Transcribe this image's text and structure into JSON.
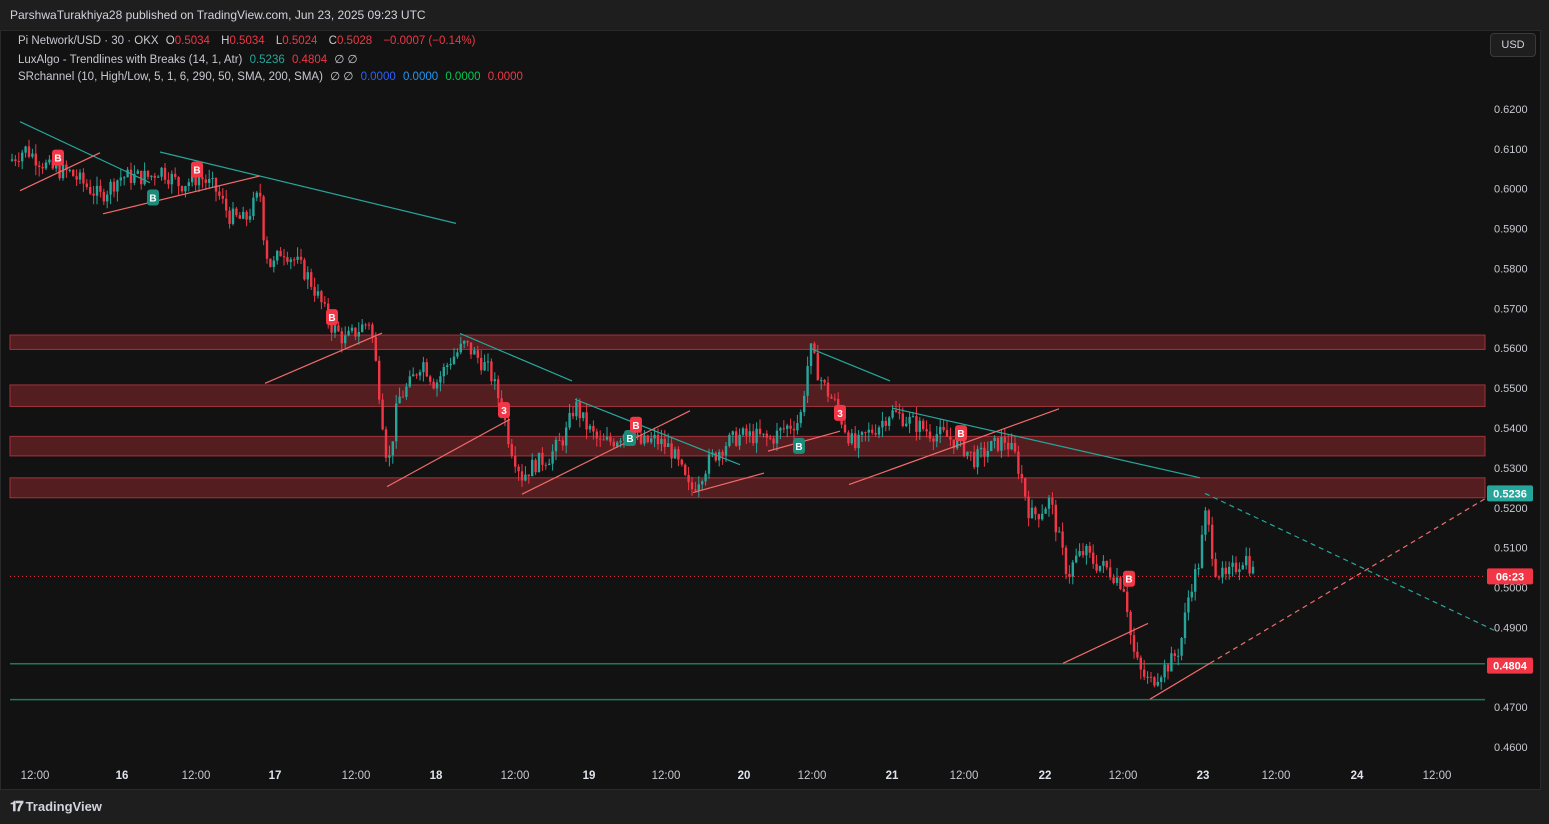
{
  "header": {
    "publisher_text": "ParshwaTurakhiya28 published on TradingView.com, Jun 23, 2025 09:23 UTC"
  },
  "legend": {
    "symbol": "Pi Network/USD · 30 · OKX",
    "o_label": "O",
    "o_value": "0.5034",
    "h_label": "H",
    "h_value": "0.5034",
    "l_label": "L",
    "l_value": "0.5024",
    "c_label": "C",
    "c_value": "0.5028",
    "change": "−0.0007 (−0.14%)",
    "indicator1_name": "LuxAlgo - Trendlines with Breaks (14, 1, Atr)",
    "indicator1_v1": "0.5236",
    "indicator1_v2": "0.4804",
    "indicator1_rest": "∅ ∅",
    "indicator2_name": "SRchannel (10, High/Low, 5, 1, 6, 290, 50, SMA, 200, SMA)",
    "indicator2_rest": "∅ ∅",
    "indicator2_v1": "0.0000",
    "indicator2_v2": "0.0000",
    "indicator2_v3": "0.0000",
    "indicator2_v4": "0.0000"
  },
  "toolbar": {
    "currency_button": "USD"
  },
  "footer": {
    "brand": "TradingView"
  },
  "colors": {
    "up": "#26a69a",
    "down": "#f23645",
    "trend_down": "#26a69a",
    "trend_up": "#f26b6b",
    "zone": "#6b2226",
    "support": "#1b7a5a"
  },
  "chart_data": {
    "type": "candlestick",
    "ylim": [
      0.456,
      0.626
    ],
    "y_ticks": [
      "0.6200",
      "0.6100",
      "0.6000",
      "0.5900",
      "0.5800",
      "0.5700",
      "0.5600",
      "0.5500",
      "0.5400",
      "0.5300",
      "0.5200",
      "0.5100",
      "0.5000",
      "0.4900",
      "0.4800",
      "0.4700",
      "0.4600"
    ],
    "x_ticks": [
      "12:00",
      "16",
      "12:00",
      "17",
      "12:00",
      "18",
      "12:00",
      "19",
      "12:00",
      "20",
      "12:00",
      "21",
      "12:00",
      "22",
      "12:00",
      "23",
      "12:00",
      "24",
      "12:00"
    ],
    "x_tick_bold": [
      false,
      true,
      false,
      true,
      false,
      true,
      false,
      true,
      false,
      true,
      false,
      true,
      false,
      true,
      false,
      true,
      false,
      true,
      false
    ],
    "x_range": [
      0,
      1475
    ],
    "x_tick_positions": [
      25,
      112,
      186,
      265,
      346,
      426,
      505,
      579,
      656,
      734,
      802,
      882,
      954,
      1035,
      1113,
      1193,
      1266,
      1347,
      1427
    ],
    "resistance_zones": [
      [
        0.5597,
        0.5633
      ],
      [
        0.5454,
        0.5508
      ],
      [
        0.533,
        0.5379
      ],
      [
        0.5225,
        0.5275
      ]
    ],
    "support_lines": [
      0.4809,
      0.4719
    ],
    "current_price": 0.5028,
    "price_labels": [
      {
        "value": 0.5236,
        "text": "0.5236",
        "color": "#26a69a"
      },
      {
        "value": 0.5028,
        "text": "06:23",
        "color": "#f23645"
      },
      {
        "value": 0.4804,
        "text": "0.4804",
        "color": "#f23645"
      }
    ],
    "waypoints": [
      [
        0,
        0.607
      ],
      [
        15,
        0.61
      ],
      [
        40,
        0.605
      ],
      [
        60,
        0.604
      ],
      [
        90,
        0.598
      ],
      [
        110,
        0.603
      ],
      [
        140,
        0.603
      ],
      [
        150,
        0.605
      ],
      [
        170,
        0.601
      ],
      [
        190,
        0.603
      ],
      [
        205,
        0.6
      ],
      [
        220,
        0.593
      ],
      [
        235,
        0.592
      ],
      [
        250,
        0.599
      ],
      [
        255,
        0.585
      ],
      [
        262,
        0.58
      ],
      [
        272,
        0.585
      ],
      [
        285,
        0.582
      ],
      [
        298,
        0.578
      ],
      [
        310,
        0.572
      ],
      [
        320,
        0.566
      ],
      [
        335,
        0.562
      ],
      [
        350,
        0.565
      ],
      [
        360,
        0.567
      ],
      [
        368,
        0.552
      ],
      [
        378,
        0.53
      ],
      [
        388,
        0.547
      ],
      [
        400,
        0.551
      ],
      [
        412,
        0.557
      ],
      [
        425,
        0.551
      ],
      [
        440,
        0.557
      ],
      [
        455,
        0.561
      ],
      [
        470,
        0.557
      ],
      [
        480,
        0.554
      ],
      [
        492,
        0.545
      ],
      [
        500,
        0.536
      ],
      [
        512,
        0.528
      ],
      [
        525,
        0.531
      ],
      [
        540,
        0.533
      ],
      [
        555,
        0.538
      ],
      [
        565,
        0.546
      ],
      [
        575,
        0.541
      ],
      [
        590,
        0.536
      ],
      [
        605,
        0.537
      ],
      [
        618,
        0.54
      ],
      [
        630,
        0.536
      ],
      [
        645,
        0.537
      ],
      [
        660,
        0.535
      ],
      [
        670,
        0.53
      ],
      [
        680,
        0.524
      ],
      [
        690,
        0.528
      ],
      [
        700,
        0.532
      ],
      [
        715,
        0.536
      ],
      [
        730,
        0.538
      ],
      [
        745,
        0.538
      ],
      [
        760,
        0.537
      ],
      [
        775,
        0.54
      ],
      [
        790,
        0.542
      ],
      [
        800,
        0.56
      ],
      [
        808,
        0.554
      ],
      [
        815,
        0.55
      ],
      [
        825,
        0.546
      ],
      [
        835,
        0.54
      ],
      [
        845,
        0.535
      ],
      [
        855,
        0.538
      ],
      [
        870,
        0.541
      ],
      [
        880,
        0.544
      ],
      [
        890,
        0.543
      ],
      [
        905,
        0.541
      ],
      [
        920,
        0.539
      ],
      [
        935,
        0.538
      ],
      [
        950,
        0.536
      ],
      [
        965,
        0.532
      ],
      [
        980,
        0.535
      ],
      [
        995,
        0.537
      ],
      [
        1005,
        0.533
      ],
      [
        1012,
        0.527
      ],
      [
        1020,
        0.518
      ],
      [
        1030,
        0.519
      ],
      [
        1040,
        0.522
      ],
      [
        1050,
        0.511
      ],
      [
        1058,
        0.503
      ],
      [
        1065,
        0.507
      ],
      [
        1075,
        0.509
      ],
      [
        1085,
        0.506
      ],
      [
        1095,
        0.505
      ],
      [
        1105,
        0.503
      ],
      [
        1115,
        0.5
      ],
      [
        1122,
        0.485
      ],
      [
        1130,
        0.479
      ],
      [
        1140,
        0.476
      ],
      [
        1150,
        0.479
      ],
      [
        1160,
        0.481
      ],
      [
        1170,
        0.485
      ],
      [
        1180,
        0.5
      ],
      [
        1188,
        0.505
      ],
      [
        1196,
        0.519
      ],
      [
        1205,
        0.505
      ],
      [
        1215,
        0.502
      ],
      [
        1225,
        0.505
      ],
      [
        1235,
        0.508
      ],
      [
        1245,
        0.503
      ]
    ],
    "trendlines": [
      {
        "kind": "down",
        "x1": 10,
        "y1": 0.6168,
        "x2": 140,
        "y2": 0.6015,
        "dash": false
      },
      {
        "kind": "down",
        "x1": 150,
        "y1": 0.6092,
        "x2": 446,
        "y2": 0.5913,
        "dash": false
      },
      {
        "kind": "down",
        "x1": 450,
        "y1": 0.5637,
        "x2": 562,
        "y2": 0.5518,
        "dash": false
      },
      {
        "kind": "down",
        "x1": 565,
        "y1": 0.5472,
        "x2": 730,
        "y2": 0.5308,
        "dash": false
      },
      {
        "kind": "down",
        "x1": 802,
        "y1": 0.5598,
        "x2": 880,
        "y2": 0.5518,
        "dash": false
      },
      {
        "kind": "down",
        "x1": 882,
        "y1": 0.545,
        "x2": 1190,
        "y2": 0.5275,
        "dash": false
      },
      {
        "kind": "down",
        "x1": 1195,
        "y1": 0.5236,
        "x2": 1484,
        "y2": 0.4893,
        "dash": true
      },
      {
        "kind": "up",
        "x1": 10,
        "y1": 0.5995,
        "x2": 90,
        "y2": 0.609,
        "dash": false
      },
      {
        "kind": "up",
        "x1": 93,
        "y1": 0.5937,
        "x2": 250,
        "y2": 0.6032,
        "dash": false
      },
      {
        "kind": "up",
        "x1": 255,
        "y1": 0.5512,
        "x2": 372,
        "y2": 0.5638,
        "dash": false
      },
      {
        "kind": "up",
        "x1": 377,
        "y1": 0.5253,
        "x2": 500,
        "y2": 0.5422,
        "dash": false
      },
      {
        "kind": "up",
        "x1": 512,
        "y1": 0.5234,
        "x2": 680,
        "y2": 0.5443,
        "dash": false
      },
      {
        "kind": "up",
        "x1": 683,
        "y1": 0.5238,
        "x2": 754,
        "y2": 0.5287,
        "dash": false
      },
      {
        "kind": "up",
        "x1": 758,
        "y1": 0.5342,
        "x2": 830,
        "y2": 0.5392,
        "dash": false
      },
      {
        "kind": "up",
        "x1": 839,
        "y1": 0.5258,
        "x2": 1049,
        "y2": 0.5448,
        "dash": false
      },
      {
        "kind": "up",
        "x1": 1053,
        "y1": 0.481,
        "x2": 1138,
        "y2": 0.491,
        "dash": false
      },
      {
        "kind": "up",
        "x1": 1140,
        "y1": 0.472,
        "x2": 1200,
        "y2": 0.481,
        "dash": false
      },
      {
        "kind": "up",
        "x1": 1200,
        "y1": 0.481,
        "x2": 1484,
        "y2": 0.5236,
        "dash": true
      }
    ],
    "markers": [
      {
        "x": 48,
        "y": 0.6078,
        "text": "B",
        "color": "#f23645"
      },
      {
        "x": 143,
        "y": 0.5978,
        "text": "B",
        "color": "#1d8a7a"
      },
      {
        "x": 187,
        "y": 0.6048,
        "text": "B",
        "color": "#f23645"
      },
      {
        "x": 322,
        "y": 0.5678,
        "text": "B",
        "color": "#f23645"
      },
      {
        "x": 494,
        "y": 0.5445,
        "text": "3",
        "color": "#f23645"
      },
      {
        "x": 620,
        "y": 0.5375,
        "text": "B",
        "color": "#1d8a7a"
      },
      {
        "x": 626,
        "y": 0.5408,
        "text": "B",
        "color": "#f23645"
      },
      {
        "x": 789,
        "y": 0.5355,
        "text": "B",
        "color": "#1d8a7a"
      },
      {
        "x": 830,
        "y": 0.5438,
        "text": "3",
        "color": "#f23645"
      },
      {
        "x": 951,
        "y": 0.5387,
        "text": "B",
        "color": "#f23645"
      },
      {
        "x": 1119,
        "y": 0.5022,
        "text": "B",
        "color": "#f23645"
      }
    ]
  }
}
